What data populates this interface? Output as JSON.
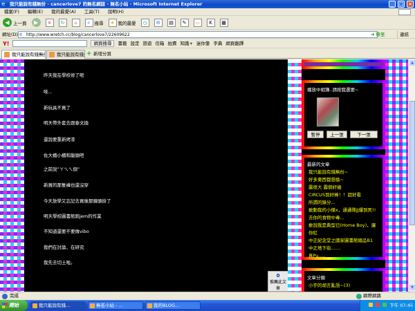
{
  "window": {
    "title": "我只能說有錢無份 - cancerlove7 的無名網誌 - 無名小站 - Microsoft Internet Explorer"
  },
  "menu": [
    "檔案(F)",
    "編輯(E)",
    "我的最愛(A)",
    "工具(T)",
    "說明(H)"
  ],
  "toolbar": {
    "back": "上一頁",
    "search": "搜尋",
    "favorites": "我的最愛"
  },
  "address": {
    "label": "網址(D)",
    "url": "http://www.wretch.cc/blog/cancerlove7/22609622",
    "go": "移至",
    "links": "連結"
  },
  "yahoo": {
    "logo": "Y!",
    "search_button": "網頁搜尋",
    "items": [
      "書籤",
      "設定",
      "旅遊",
      "信箱",
      "拍賣",
      "知識+",
      "迷你筆",
      "字典",
      "網頁翻譯"
    ]
  },
  "tabs": {
    "items": [
      {
        "label": "我只能說有錢無份 - ..."
      },
      {
        "label": "我只能說有錢無份 - cancerlo..."
      }
    ],
    "new_tab": "新增分頁"
  },
  "post": {
    "lines": [
      "昨天我在學校修了呢",
      "唉...",
      "新玩具不買了",
      "明天帶外套去跟泰文換",
      "還說要重新烤漆",
      "佐大橋小橋和龍頭吧",
      "之前說”ㄚㄟㄟ倒”",
      "新買的那隻褲也還沒穿",
      "今天放學又忘記去買後那鏡頭掛了",
      "明天學校圖書館跑jem的作業",
      "不知道還要不要做vibo",
      "我們在討論、在研究",
      "我先去切土啦。"
    ],
    "recommend_count": "0",
    "recommend_label": "推薦此文章"
  },
  "sidebar": {
    "player": {
      "title": "播放中相簿..請按我選要~",
      "buttons": [
        "暫停",
        "上一張",
        "下一張"
      ]
    },
    "recent": {
      "title": "最新的文章",
      "items": [
        "我只能說有錢無份~",
        "好多東西都想換~",
        "震很大 震倒好幾",
        "CIRCUS到好棒！！超好看",
        "所謂的錄分...",
        "敢動我的小傑x，通通隊JJ爆到死!!",
        "去你的食物中毒...",
        "敢說我是典型已(Home Boy)，讓",
        "你紅",
        "中正紀念堂之國家圖書館總品B1",
        "中正地下街.......",
        "真Pu....."
      ]
    },
    "category": {
      "title": "文章分類",
      "items": [
        "小宇的胡言亂語~(3)"
      ]
    }
  },
  "status": {
    "text": "完成",
    "zone": "網際網路"
  },
  "taskbar": {
    "start": "開始",
    "apps": [
      "我只能說有錢...",
      "無名小站 - ...",
      "我的BLOG..."
    ],
    "time": "下午 07:45"
  }
}
